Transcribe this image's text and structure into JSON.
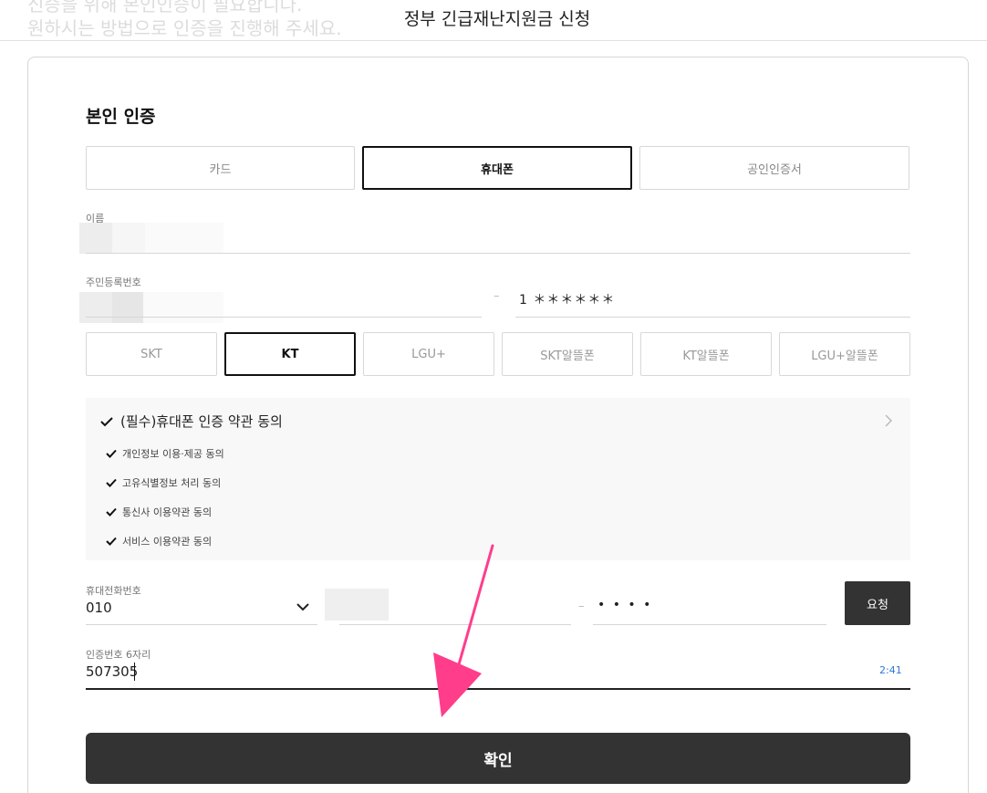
{
  "header": {
    "background_text": "신증을 위해 본인인증이 필요합니다.\n원하시는 방법으로 인증을 진행해 주세요.",
    "title": "정부 긴급재난지원금 신청"
  },
  "auth": {
    "section_title": "본인 인증",
    "methods": [
      {
        "label": "카드",
        "active": false
      },
      {
        "label": "휴대폰",
        "active": true
      },
      {
        "label": "공인인증서",
        "active": false
      }
    ]
  },
  "form": {
    "name_label": "이름",
    "rrn_label": "주민등록번호",
    "rrn_dash": "–",
    "rrn_back": "1 ＊＊＊＊＊＊",
    "carriers": [
      {
        "label": "SKT",
        "active": false
      },
      {
        "label": "KT",
        "active": true
      },
      {
        "label": "LGU+",
        "active": false
      },
      {
        "label": "SKT알뜰폰",
        "active": false
      },
      {
        "label": "KT알뜰폰",
        "active": false
      },
      {
        "label": "LGU+알뜰폰",
        "active": false
      }
    ],
    "agreements": {
      "main": "(필수)휴대폰 인증 약관 동의",
      "items": [
        "개인정보 이용·제공 동의",
        "고유식별정보 처리 동의",
        "통신사 이용약관 동의",
        "서비스 이용약관 동의"
      ]
    },
    "phone_label": "휴대전화번호",
    "phone_prefix": "010",
    "phone_dash": "–",
    "phone_last": "• • • •",
    "request_label": "요청",
    "code_label": "인증번호 6자리",
    "code_value": "507305",
    "timer": "2:41",
    "confirm_label": "확인"
  },
  "colors": {
    "accent_dark": "#333333",
    "timer_blue": "#2a7ad6",
    "annotation_arrow": "#ff3d8b"
  },
  "icons": [
    "check-icon",
    "chevron-right-icon",
    "chevron-down-icon",
    "annotation-arrow-icon"
  ]
}
